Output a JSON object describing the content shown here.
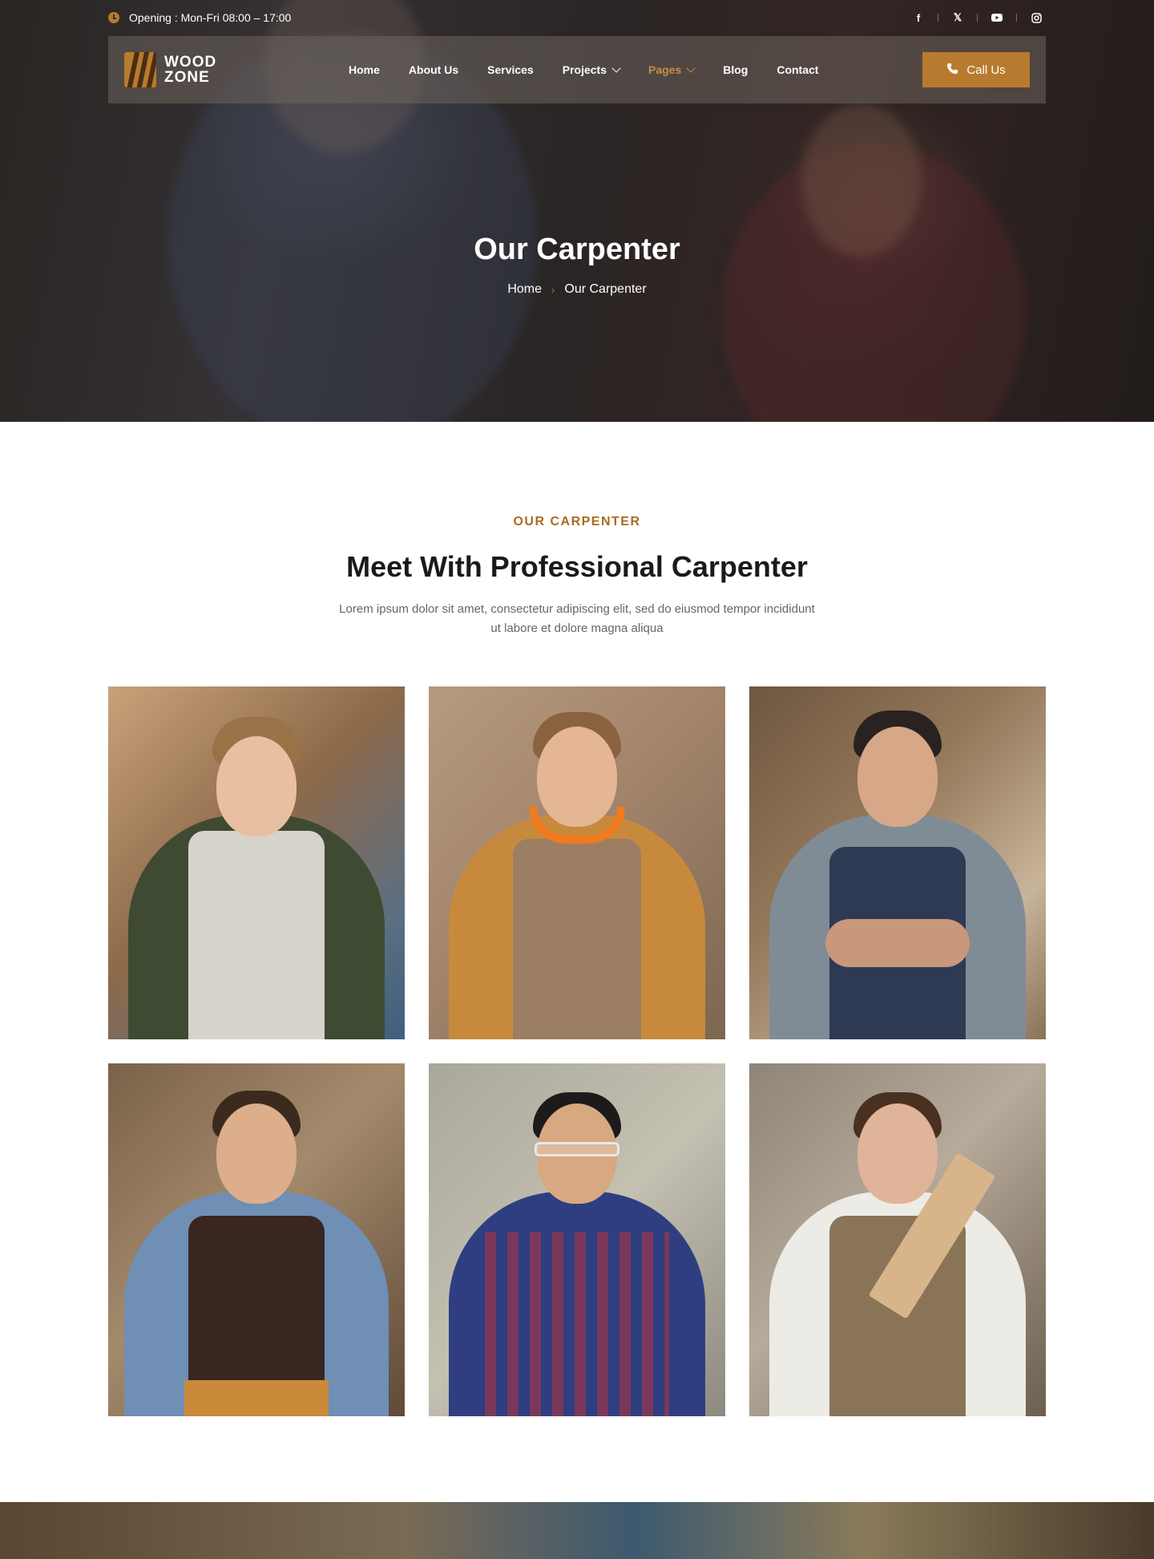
{
  "topbar": {
    "opening": "Opening : Mon-Fri 08:00 – 17:00",
    "socials": [
      "facebook-icon",
      "x-icon",
      "youtube-icon",
      "instagram-icon"
    ]
  },
  "logo": {
    "line1": "WOOD",
    "line2": "ZONE"
  },
  "nav": {
    "items": [
      {
        "label": "Home"
      },
      {
        "label": "About Us"
      },
      {
        "label": "Services"
      },
      {
        "label": "Projects"
      },
      {
        "label": "Pages"
      },
      {
        "label": "Blog"
      },
      {
        "label": "Contact"
      }
    ],
    "active": "Pages",
    "cta": "Call Us"
  },
  "hero": {
    "title": "Our Carpenter",
    "breadcrumb": [
      "Home",
      "Our Carpenter"
    ]
  },
  "team": {
    "kicker": "OUR CARPENTER",
    "title": "Meet With Professional Carpenter",
    "description": "Lorem ipsum dolor sit amet, consectetur adipiscing elit, sed do eiusmod tempor incididunt ut labore et dolore magna aliqua"
  },
  "colors": {
    "accent": "#b87a2e",
    "kicker": "#a86c22",
    "title": "#1a1a1a",
    "text": "#666666"
  }
}
